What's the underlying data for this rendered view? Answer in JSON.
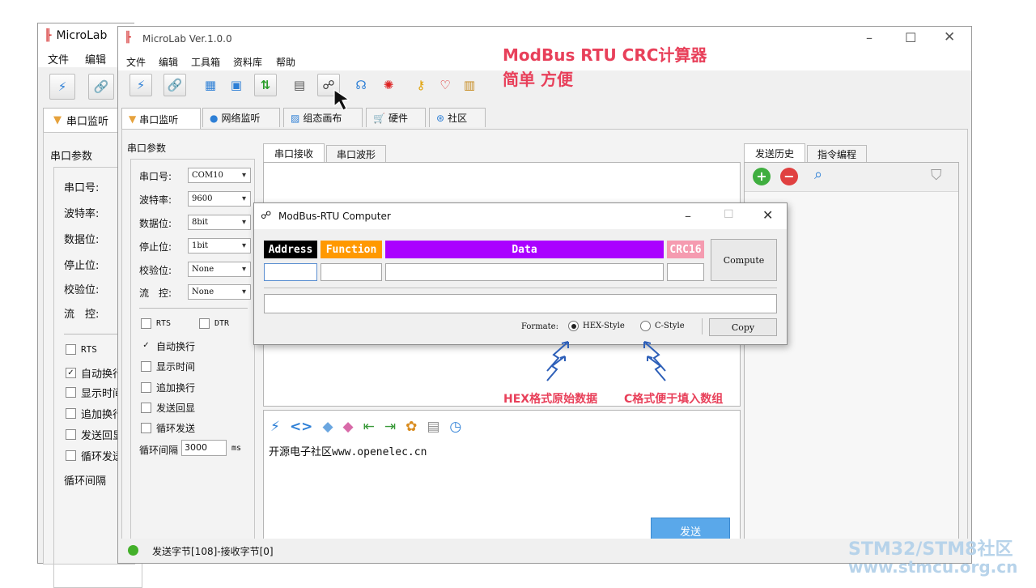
{
  "back_window": {
    "title": "MicroLab",
    "menu": [
      "文件",
      "编辑"
    ],
    "tab_label": "串口监听",
    "section": "串口参数",
    "params": [
      "串口号:",
      "波特率:",
      "数据位:",
      "停止位:",
      "校验位:",
      "流　控:"
    ],
    "checks": [
      {
        "label": "RTS",
        "checked": false
      },
      {
        "label": "自动换行",
        "checked": true
      },
      {
        "label": "显示时间",
        "checked": false
      },
      {
        "label": "追加换行",
        "checked": false
      },
      {
        "label": "发送回显",
        "checked": false
      },
      {
        "label": "循环发送",
        "checked": false
      }
    ],
    "loop_label": "循环间隔"
  },
  "main_window": {
    "title": "MicroLab Ver.1.0.0",
    "menu": [
      "文件",
      "编辑",
      "工具箱",
      "资料库",
      "帮助"
    ],
    "tabs": [
      "串口监听",
      "网络监听",
      "组态画布",
      "硬件",
      "社区"
    ],
    "section": "串口参数",
    "params": [
      {
        "label": "串口号:",
        "value": "COM10"
      },
      {
        "label": "波特率:",
        "value": "9600"
      },
      {
        "label": "数据位:",
        "value": "8bit"
      },
      {
        "label": "停止位:",
        "value": "1bit"
      },
      {
        "label": "校验位:",
        "value": "None"
      },
      {
        "label": "流　控:",
        "value": "None"
      }
    ],
    "rts": "RTS",
    "dtr": "DTR",
    "checks": [
      {
        "label": "自动换行",
        "checked": true
      },
      {
        "label": "显示时间",
        "checked": false
      },
      {
        "label": "追加换行",
        "checked": false
      },
      {
        "label": "发送回显",
        "checked": false
      },
      {
        "label": "循环发送",
        "checked": false
      }
    ],
    "loop_label": "循环间隔",
    "loop_value": "3000",
    "loop_unit": "ms",
    "rx_tabs": [
      "串口接收",
      "串口波形"
    ],
    "send_text": "开源电子社区www.openelec.cn",
    "send_button": "发送",
    "status": "发送字节[108]-接收字节[0]",
    "history_tabs": [
      "发送历史",
      "指令编程"
    ]
  },
  "dialog": {
    "title": "ModBus-RTU Computer",
    "headers": [
      "Address",
      "Function",
      "Data",
      "CRC16"
    ],
    "compute": "Compute",
    "format_label": "Formate:",
    "options": [
      {
        "label": "HEX-Style",
        "selected": true
      },
      {
        "label": "C-Style",
        "selected": false
      }
    ],
    "copy": "Copy"
  },
  "annotations": {
    "title_line1": "ModBus RTU CRC计算器",
    "title_line2": "简单 方便",
    "hex_note": "HEX格式原始数据",
    "c_note": "C格式便于填入数组"
  },
  "watermark": {
    "line1": "STM32/STM8社区",
    "line2": "www.stmcu.org.cn"
  },
  "colors": {
    "address": "#000000",
    "function": "#ff9900",
    "data": "#aa00ff",
    "crc": "#f59bb0",
    "annotation": "#e8405a",
    "send_button": "#5aa8ea"
  }
}
